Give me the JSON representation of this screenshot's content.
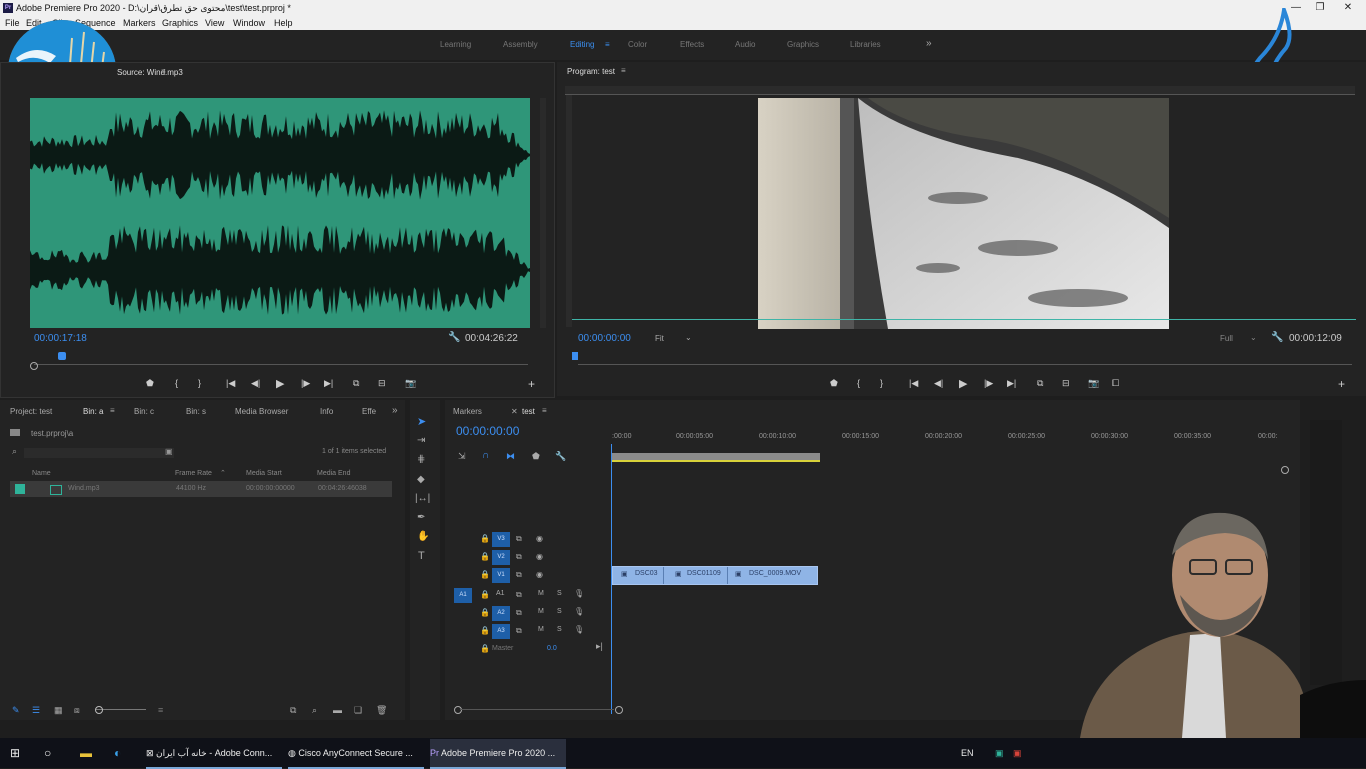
{
  "window": {
    "title": "Adobe Premiere Pro 2020 - D:\\محتوی حق تطرق\\قران\\test\\test.prproj *",
    "app_badge": "Pr",
    "controls": [
      "—",
      "❐",
      "✕"
    ]
  },
  "menu": [
    "File",
    "Edit",
    "Clip",
    "Sequence",
    "Markers",
    "Graphics",
    "View",
    "Window",
    "Help"
  ],
  "workspaces": [
    "Learning",
    "Assembly",
    "Editing",
    "Color",
    "Effects",
    "Audio",
    "Graphics",
    "Libraries",
    "»"
  ],
  "source_monitor": {
    "tab": "Source: Wind.mp3",
    "current_time": "00:00:17:18",
    "duration": "00:04:26:22"
  },
  "program_monitor": {
    "tab": "Program: test",
    "current_time": "00:00:00:00",
    "fit": "Fit",
    "quality": "Full",
    "duration": "00:00:12:09"
  },
  "project_panel": {
    "tabs": [
      "Project: test",
      "Bin: a",
      "Bin: c",
      "Bin: s",
      "Media Browser",
      "Info",
      "Effe"
    ],
    "path": "test.prproj\\a",
    "items_selected": "1 of 1 items selected",
    "columns": [
      "Name",
      "Frame Rate",
      "Media Start",
      "Media End"
    ],
    "rows": [
      {
        "name": "Wind.mp3",
        "frame_rate": "44100 Hz",
        "media_start": "00:00:00:00000",
        "media_end": "00:04:26:46038"
      }
    ]
  },
  "timeline": {
    "tabs": [
      "Markers",
      "test"
    ],
    "playhead": "00:00:00:00",
    "ruler": [
      ":00:00",
      "00:00:05:00",
      "00:00:10:00",
      "00:00:15:00",
      "00:00:20:00",
      "00:00:25:00",
      "00:00:30:00",
      "00:00:35:00",
      "00:00:"
    ],
    "video_tracks": [
      "V3",
      "V2",
      "V1"
    ],
    "audio_tracks": [
      "A1",
      "A2",
      "A3"
    ],
    "source_patch": [
      "V1",
      "A1"
    ],
    "master": "Master",
    "master_value": "0.0",
    "clips": [
      "DSC03",
      "DSC01109",
      "DSC_0009.MOV"
    ],
    "track_flags": [
      "M",
      "S"
    ]
  },
  "taskbar": {
    "items": [
      "خانه آب ایران - Adobe Conn...",
      "Cisco AnyConnect Secure ...",
      "Adobe Premiere Pro 2020 ..."
    ],
    "lang": "EN"
  },
  "colors": {
    "waveform_bg": "#2f9679",
    "accent": "#3c8ef0",
    "panel": "#232323"
  }
}
